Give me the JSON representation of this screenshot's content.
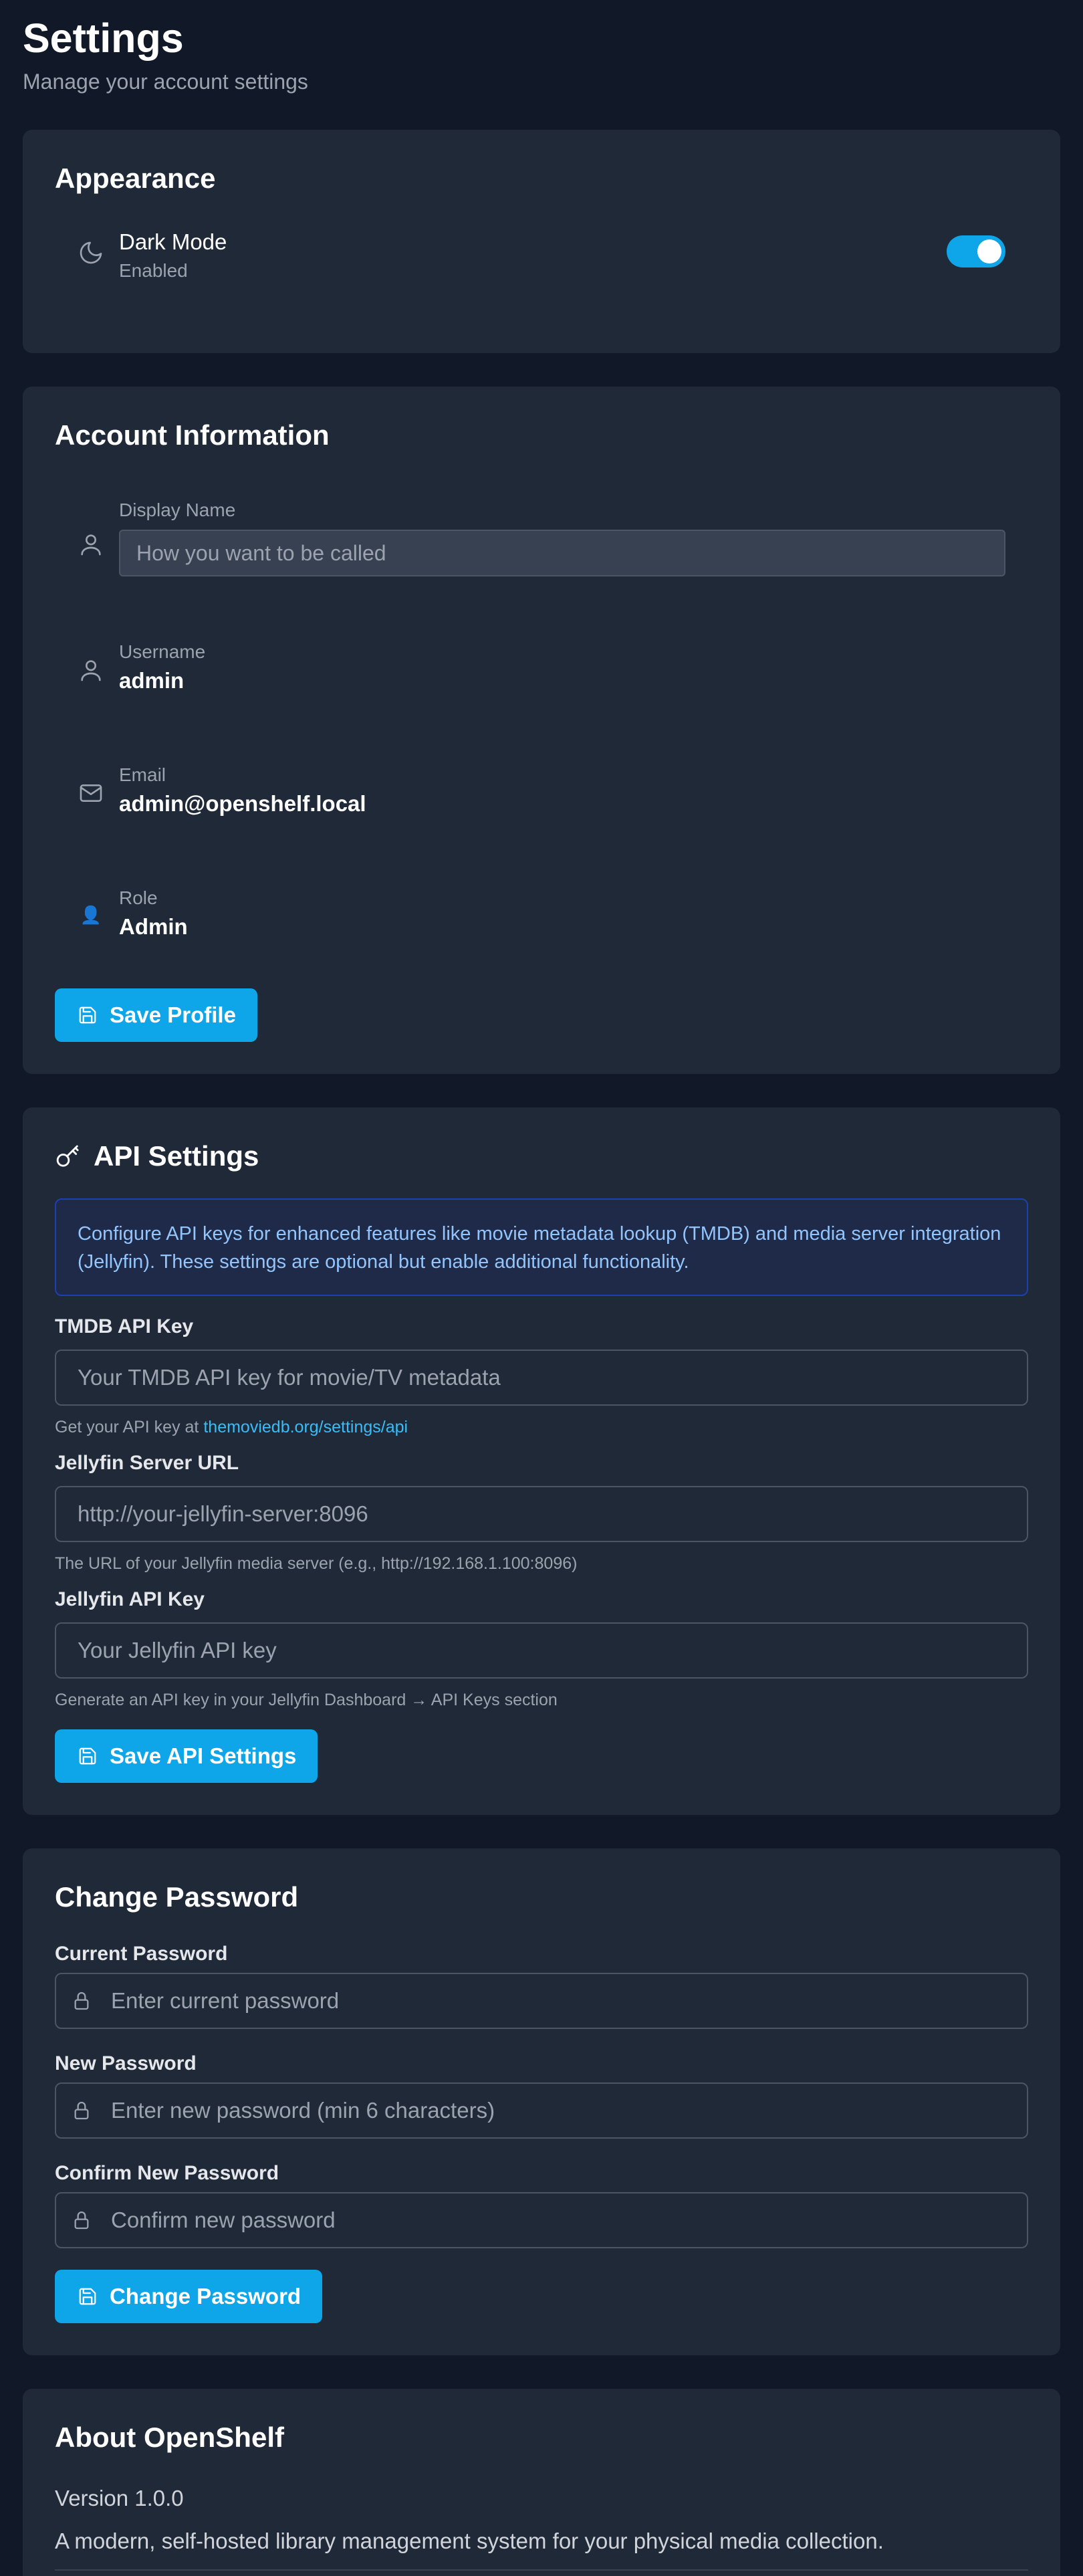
{
  "header": {
    "title": "Settings",
    "subtitle": "Manage your account settings"
  },
  "appearance": {
    "title": "Appearance",
    "dark_mode_label": "Dark Mode",
    "dark_mode_status": "Enabled",
    "dark_mode_on": true
  },
  "account": {
    "title": "Account Information",
    "display_name_label": "Display Name",
    "display_name_value": "",
    "display_name_placeholder": "How you want to be called",
    "username_label": "Username",
    "username_value": "admin",
    "email_label": "Email",
    "email_value": "admin@openshelf.local",
    "role_label": "Role",
    "role_icon": "👤",
    "role_value": "Admin",
    "save_label": "Save Profile"
  },
  "api": {
    "title": "API Settings",
    "notice": "Configure API keys for enhanced features like movie metadata lookup (TMDB) and media server integration (Jellyfin). These settings are optional but enable additional functionality.",
    "tmdb_label": "TMDB API Key",
    "tmdb_value": "",
    "tmdb_placeholder": "Your TMDB API key for movie/TV metadata",
    "tmdb_help_prefix": "Get your API key at",
    "tmdb_help_link": "themoviedb.org/settings/api",
    "jellyfin_url_label": "Jellyfin Server URL",
    "jellyfin_url_value": "",
    "jellyfin_url_placeholder": "http://your-jellyfin-server:8096",
    "jellyfin_url_help": "The URL of your Jellyfin media server (e.g., http://192.168.1.100:8096)",
    "jellyfin_key_label": "Jellyfin API Key",
    "jellyfin_key_value": "",
    "jellyfin_key_placeholder": "Your Jellyfin API key",
    "jellyfin_key_help": "Generate an API key in your Jellyfin Dashboard → API Keys section",
    "save_label": "Save API Settings"
  },
  "password": {
    "title": "Change Password",
    "current_label": "Current Password",
    "current_placeholder": "Enter current password",
    "new_label": "New Password",
    "new_placeholder": "Enter new password (min 6 characters)",
    "confirm_label": "Confirm New Password",
    "confirm_placeholder": "Confirm new password",
    "submit_label": "Change Password"
  },
  "about": {
    "title": "About OpenShelf",
    "version": "Version 1.0.0",
    "description": "A modern, self-hosted library management system for your physical media collection."
  },
  "colors": {
    "background": "#111827",
    "card": "#1f2937",
    "accent": "#0ea5e9",
    "link": "#38bdf8",
    "notice_text": "#93c5fd"
  }
}
